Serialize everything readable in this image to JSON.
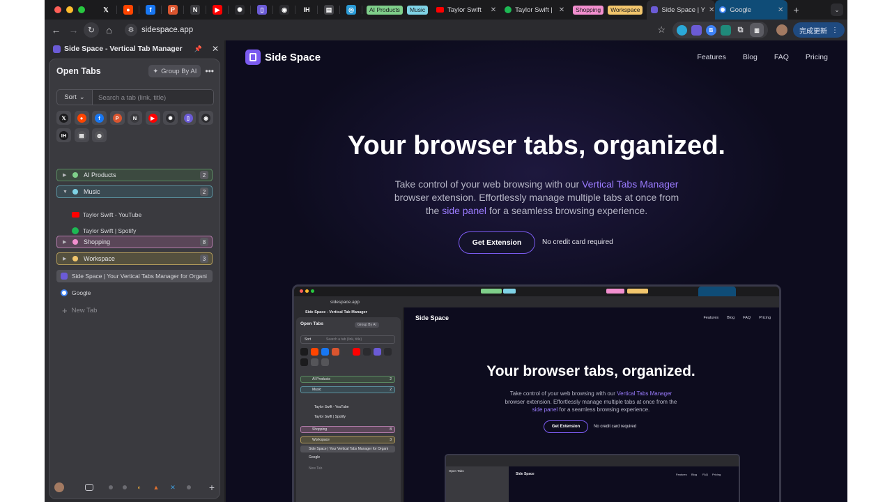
{
  "tabstrip": {
    "pinned": [
      {
        "name": "x-icon",
        "glyph": "𝕏",
        "color": "#1b1b1d"
      },
      {
        "name": "reddit-icon",
        "glyph": "●",
        "color": "#ff4500"
      },
      {
        "name": "facebook-icon",
        "glyph": "f",
        "color": "#1877f2"
      },
      {
        "name": "producthunt-icon",
        "glyph": "P",
        "color": "#da552f"
      },
      {
        "name": "notion-icon",
        "glyph": "N",
        "color": "#3a3a3e"
      },
      {
        "name": "youtube-icon",
        "glyph": "▶",
        "color": "#ff0000"
      },
      {
        "name": "openai-icon",
        "glyph": "✺",
        "color": "#2b2b2f"
      },
      {
        "name": "sidespace-icon",
        "glyph": "▯",
        "color": "#6b5bd6"
      },
      {
        "name": "github-icon",
        "glyph": "◉",
        "color": "#2b2b2f"
      },
      {
        "name": "indiehackers-icon",
        "glyph": "IH",
        "color": "#1b1b1d"
      },
      {
        "name": "notebook-icon",
        "glyph": "▤",
        "color": "#444448"
      },
      {
        "name": "translate-icon",
        "glyph": "◎",
        "color": "#2a9bd6"
      }
    ],
    "groups": [
      {
        "label": "AI Products",
        "color": "#7fcf8a"
      },
      {
        "label": "Music",
        "color": "#7fd3e6"
      }
    ],
    "tabs": [
      {
        "label": "Taylor Swift",
        "icon": "youtube-icon",
        "color": "#ff0000"
      },
      {
        "label": "Taylor Swift |",
        "icon": "spotify-icon",
        "color": "#1db954"
      }
    ],
    "groups2": [
      {
        "label": "Shopping",
        "color": "#f28fcf"
      },
      {
        "label": "Workspace",
        "color": "#f2c66d"
      }
    ],
    "active_tab": "Side Space | Y",
    "google_tab": "Google",
    "close": "✕",
    "new_tab": "+",
    "menu": "⌄"
  },
  "toolbar": {
    "back": "←",
    "forward": "→",
    "reload": "↻",
    "home": "⌂",
    "url": "sidespace.app",
    "star": "☆",
    "update": "完成更新",
    "update_menu": "⋮"
  },
  "sidepanel": {
    "title": "Side Space - Vertical Tab Manager",
    "pin": "📌",
    "close": "✕",
    "open_tabs": "Open Tabs",
    "group_by_ai": "Group By AI",
    "more": "•••",
    "sort": "Sort",
    "search_placeholder": "Search a tab (link, title)",
    "favorites": [
      {
        "name": "x-icon",
        "glyph": "𝕏",
        "color": "#1b1b1d"
      },
      {
        "name": "reddit-icon",
        "glyph": "●",
        "color": "#ff4500"
      },
      {
        "name": "facebook-icon",
        "glyph": "f",
        "color": "#1877f2"
      },
      {
        "name": "producthunt-icon",
        "glyph": "P",
        "color": "#da552f"
      },
      {
        "name": "notion-icon",
        "glyph": "N",
        "color": "#3a3a3e"
      },
      {
        "name": "youtube-icon",
        "glyph": "▶",
        "color": "#ff0000"
      },
      {
        "name": "openai-icon",
        "glyph": "✺",
        "color": "#2b2b2f"
      },
      {
        "name": "sidespace-icon",
        "glyph": "▯",
        "color": "#6b5bd6"
      },
      {
        "name": "github-icon",
        "glyph": "◉",
        "color": "#2b2b2f"
      },
      {
        "name": "indiehackers-icon",
        "glyph": "IH",
        "color": "#1b1b1d"
      },
      {
        "name": "notebook-icon",
        "glyph": "▤",
        "color": "#555559"
      },
      {
        "name": "globe-icon",
        "glyph": "◍",
        "color": "#555559"
      }
    ],
    "groups": [
      {
        "label": "AI Products",
        "count": "2",
        "color": "#7fcf8a",
        "border": "#5a8a62",
        "bg": "#3c4a40",
        "expanded": false
      },
      {
        "label": "Music",
        "count": "2",
        "color": "#7fd3e6",
        "border": "#5a8f9c",
        "bg": "#3a4a52",
        "expanded": true
      },
      {
        "label": "Shopping",
        "count": "8",
        "color": "#f28fcf",
        "border": "#b07aa8",
        "bg": "#5a4658",
        "expanded": false
      },
      {
        "label": "Workspace",
        "count": "3",
        "color": "#f2c66d",
        "border": "#b0995a",
        "bg": "#54503e",
        "expanded": false
      }
    ],
    "music_tabs": [
      {
        "label": "Taylor Swift - YouTube",
        "icon": "youtube-icon",
        "color": "#ff0000",
        "glyph": "▶"
      },
      {
        "label": "Taylor Swift | Spotify",
        "icon": "spotify-icon",
        "color": "#1db954",
        "glyph": "≋"
      }
    ],
    "active_tab": "Side Space | Your Vertical Tabs Manager for Organi",
    "google_tab": "Google",
    "new_tab": "New Tab",
    "plus": "+"
  },
  "page": {
    "brand": "Side Space",
    "nav": [
      "Features",
      "Blog",
      "FAQ",
      "Pricing"
    ],
    "hero_title": "Your browser tabs, organized.",
    "sub_1": "Take control of your web browsing with our ",
    "sub_hl1": "Vertical Tabs Manager",
    "sub_2": " browser extension. Effortlessly manage multiple tabs at once from the ",
    "sub_hl2": "side panel",
    "sub_3": " for a seamless browsing experience.",
    "cta": "Get Extension",
    "cta_note": "No credit card required"
  },
  "preview": {
    "url": "sidespace.app",
    "side_title": "Side Space - Vertical Tab Manager",
    "open_tabs": "Open Tabs",
    "group_by_ai": "Group By AI",
    "sort": "Sort",
    "search_placeholder": "Search a tab (link, title)",
    "groups": [
      "AI Products",
      "Music",
      "Shopping",
      "Workspace"
    ],
    "counts": [
      "2",
      "2",
      "8",
      "3"
    ],
    "music_tabs": [
      "Taylor Swift - YouTube",
      "Taylor Swift | Spotify"
    ],
    "active_tab": "Side Space | Your Vertical Tabs Manager for Organi",
    "google": "Google",
    "new_tab": "New Tab",
    "brand": "Side Space",
    "nav": [
      "Features",
      "Blog",
      "FAQ",
      "Pricing"
    ],
    "hero_title": "Your browser tabs, organized.",
    "sub_1": "Take control of your web browsing with our ",
    "sub_hl1": "Vertical Tabs Manager",
    "sub_2": " browser extension. Effortlessly manage multiple tabs at once from the ",
    "sub_hl2": "side panel",
    "sub_3": " for a seamless browsing experience.",
    "cta": "Get Extension",
    "cta_note": "No credit card required",
    "nested_brand": "Side Space",
    "nested_nav": [
      "Features",
      "Blog",
      "FAQ",
      "Pricing"
    ],
    "nested_open_tabs": "Open Tabs"
  }
}
